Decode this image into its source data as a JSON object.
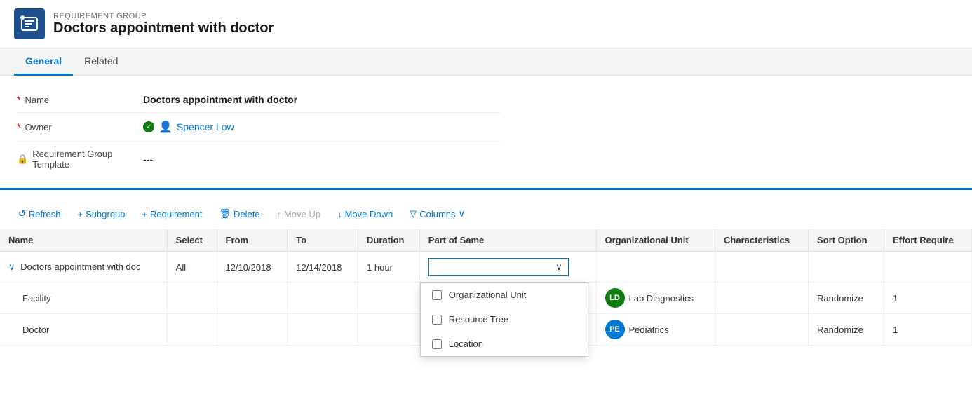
{
  "header": {
    "category": "REQUIREMENT GROUP",
    "title": "Doctors appointment with doctor",
    "icon_label": "requirement-group-icon"
  },
  "tabs": [
    {
      "label": "General",
      "active": true
    },
    {
      "label": "Related",
      "active": false
    }
  ],
  "form": {
    "fields": [
      {
        "label": "Name",
        "required": true,
        "value": "Doctors appointment with doctor",
        "bold": true
      },
      {
        "label": "Owner",
        "required": true,
        "value": "Spencer Low",
        "type": "owner"
      },
      {
        "label": "Requirement Group Template",
        "required": false,
        "value": "---",
        "type": "lock"
      }
    ]
  },
  "toolbar": {
    "buttons": [
      {
        "label": "Refresh",
        "icon": "↺",
        "disabled": false
      },
      {
        "label": "Subgroup",
        "icon": "+",
        "disabled": false
      },
      {
        "label": "Requirement",
        "icon": "+",
        "disabled": false
      },
      {
        "label": "Delete",
        "icon": "🗑",
        "disabled": false
      },
      {
        "label": "Move Up",
        "icon": "↑",
        "disabled": true
      },
      {
        "label": "Move Down",
        "icon": "↓",
        "disabled": false
      },
      {
        "label": "Columns",
        "icon": "▽",
        "disabled": false
      }
    ]
  },
  "table": {
    "columns": [
      {
        "label": "Name",
        "key": "name"
      },
      {
        "label": "Select",
        "key": "select"
      },
      {
        "label": "From",
        "key": "from"
      },
      {
        "label": "To",
        "key": "to"
      },
      {
        "label": "Duration",
        "key": "duration"
      },
      {
        "label": "Part of Same",
        "key": "part_of_same"
      },
      {
        "label": "Organizational Unit",
        "key": "org_unit"
      },
      {
        "label": "Characteristics",
        "key": "characteristics"
      },
      {
        "label": "Sort Option",
        "key": "sort_option"
      },
      {
        "label": "Effort Require",
        "key": "effort_require"
      }
    ],
    "rows": [
      {
        "name": "Doctors appointment with doc",
        "expanded": true,
        "select": "All",
        "from": "12/10/2018",
        "to": "12/14/2018",
        "duration": "1 hour",
        "part_of_same": "",
        "org_unit": "",
        "org_avatar": "",
        "org_initials": "",
        "characteristics": "",
        "sort_option": "",
        "effort_require": ""
      },
      {
        "name": "Facility",
        "expanded": false,
        "indent": true,
        "select": "",
        "from": "",
        "to": "",
        "duration": "",
        "part_of_same": "",
        "org_unit": "Lab Diagnostics",
        "org_avatar": "ld",
        "org_initials": "LD",
        "characteristics": "",
        "sort_option": "Randomize",
        "effort_require": "1"
      },
      {
        "name": "Doctor",
        "expanded": false,
        "indent": true,
        "select": "",
        "from": "",
        "to": "",
        "duration": "",
        "part_of_same": "",
        "org_unit": "Pediatrics",
        "org_avatar": "pe",
        "org_initials": "PE",
        "characteristics": "",
        "sort_option": "Randomize",
        "effort_require": "1"
      }
    ],
    "dropdown_options": [
      {
        "label": "Organizational Unit",
        "checked": false
      },
      {
        "label": "Resource Tree",
        "checked": false
      },
      {
        "label": "Location",
        "checked": false
      }
    ]
  }
}
